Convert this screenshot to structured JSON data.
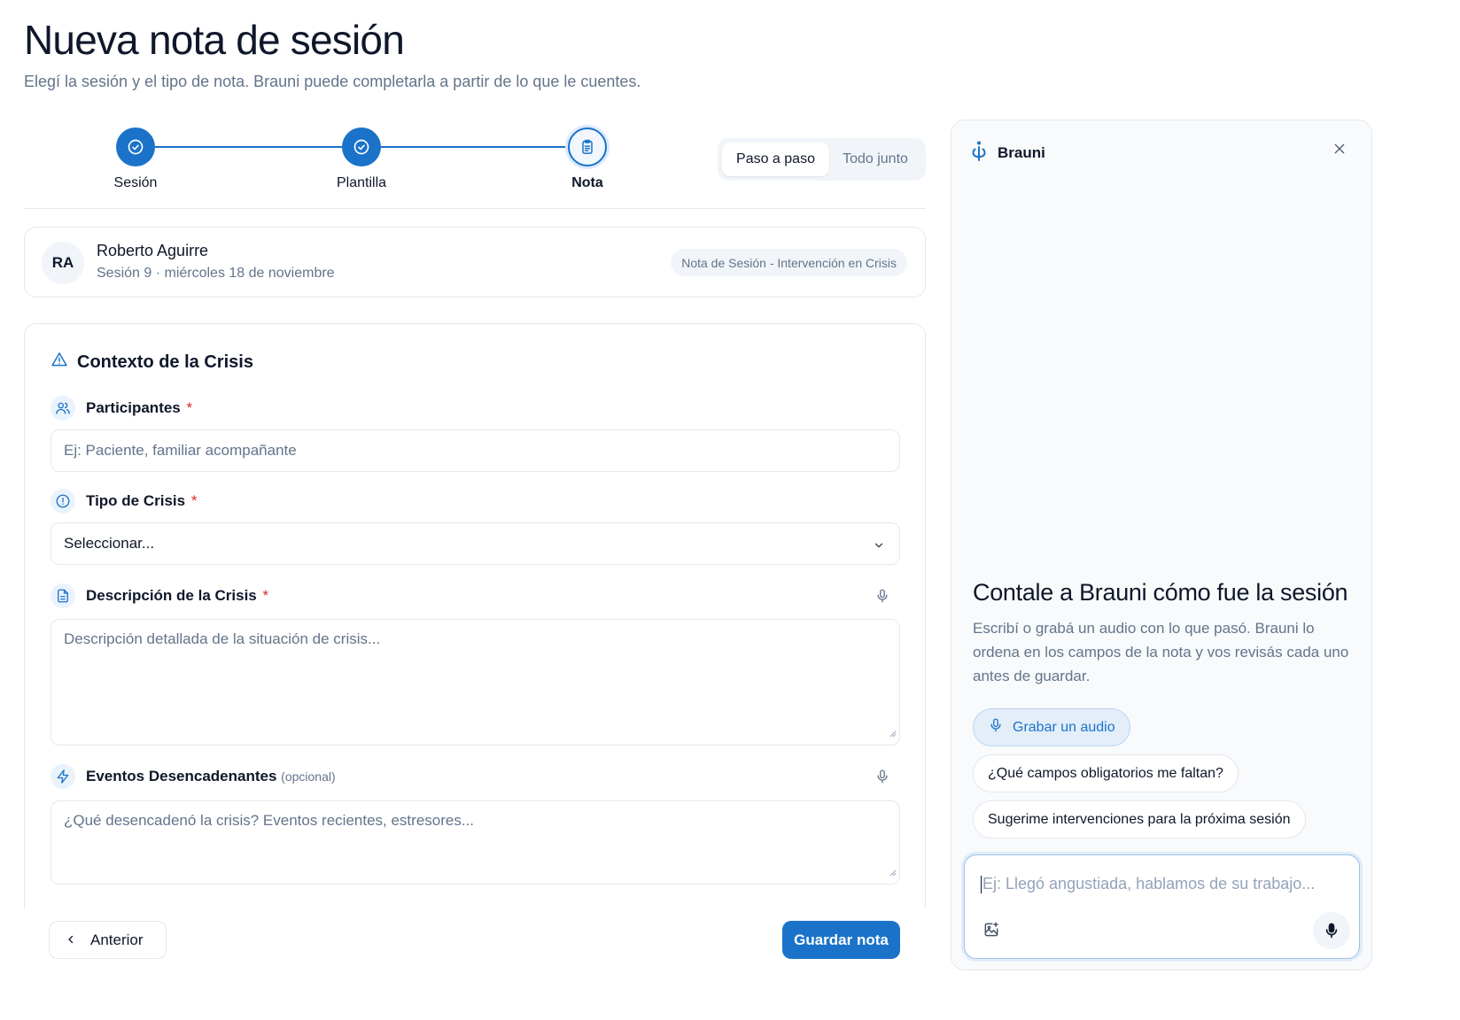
{
  "page": {
    "title": "Nueva nota de sesión",
    "subtitle": "Elegí la sesión y el tipo de nota. Brauni puede completarla a partir de lo que le cuentes."
  },
  "stepper": {
    "steps": [
      {
        "label": "Sesión",
        "state": "done"
      },
      {
        "label": "Plantilla",
        "state": "done"
      },
      {
        "label": "Nota",
        "state": "current"
      }
    ],
    "accent": "#1a73c9"
  },
  "mode_toggle": {
    "options": [
      "Paso a paso",
      "Todo junto"
    ],
    "selected": "Paso a paso"
  },
  "patient": {
    "initials": "RA",
    "name": "Roberto Aguirre",
    "meta": "Sesión 9 · miércoles 18 de noviembre",
    "template": "Nota de Sesión - Intervención en Crisis"
  },
  "form": {
    "section_title": "Contexto de la Crisis",
    "fields": [
      {
        "label": "Participantes",
        "required": "*",
        "icon": "users-icon",
        "placeholder": "Ej: Paciente, familiar acompañante"
      },
      {
        "label": "Tipo de Crisis",
        "required": "*",
        "icon": "alert-circle-icon",
        "value": "Seleccionar..."
      },
      {
        "label": "Descripción de la Crisis",
        "required": "*",
        "icon": "file-text-icon",
        "placeholder": "Descripción detallada de la situación de crisis..."
      },
      {
        "label": "Eventos Desencadenantes",
        "optional": "(opcional)",
        "icon": "zap-icon",
        "placeholder": "¿Qué desencadenó la crisis? Eventos recientes, estresores..."
      }
    ]
  },
  "actions": {
    "prev_label": "Anterior",
    "save_label": "Guardar nota"
  },
  "assistant": {
    "name": "Brauni",
    "title": "Contale a Brauni cómo fue la sesión",
    "description": "Escribí o grabá un audio con lo que pasó. Brauni lo ordena en los campos de la nota y vos revisás cada uno antes de guardar.",
    "chips": [
      "Grabar un audio",
      "¿Qué campos obligatorios me faltan?",
      "Sugerime intervenciones para la próxima sesión"
    ],
    "composer_placeholder": "Ej: Llegó angustiada, hablamos de su trabajo..."
  }
}
